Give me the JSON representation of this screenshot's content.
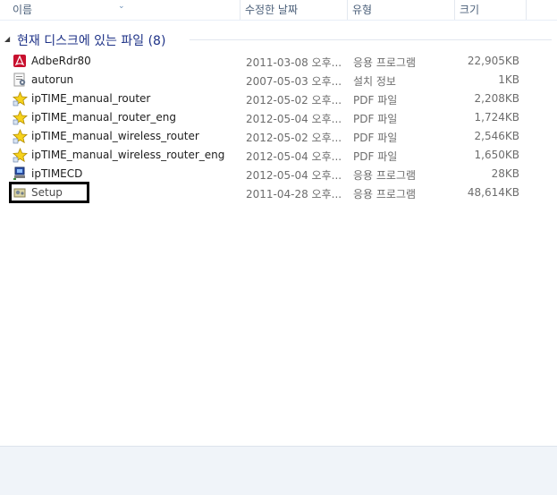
{
  "columns": {
    "name": "이름",
    "date": "수정한 날짜",
    "type": "유형",
    "size": "크기"
  },
  "group": {
    "title": "현재 디스크에 있는 파일 (8)"
  },
  "files": [
    {
      "name": "AdbeRdr80",
      "date": "2011-03-08 오후...",
      "type": "응용 프로그램",
      "size": "22,905KB",
      "icon": "adobe-reader-icon"
    },
    {
      "name": "autorun",
      "date": "2007-05-03 오후...",
      "type": "설치 정보",
      "size": "1KB",
      "icon": "setup-info-icon"
    },
    {
      "name": "ipTIME_manual_router",
      "date": "2012-05-02 오후...",
      "type": "PDF 파일",
      "size": "2,208KB",
      "icon": "pdf-star-icon"
    },
    {
      "name": "ipTIME_manual_router_eng",
      "date": "2012-05-04 오후...",
      "type": "PDF 파일",
      "size": "1,724KB",
      "icon": "pdf-star-icon"
    },
    {
      "name": "ipTIME_manual_wireless_router",
      "date": "2012-05-02 오후...",
      "type": "PDF 파일",
      "size": "2,546KB",
      "icon": "pdf-star-icon"
    },
    {
      "name": "ipTIME_manual_wireless_router_eng",
      "date": "2012-05-04 오후...",
      "type": "PDF 파일",
      "size": "1,650KB",
      "icon": "pdf-star-icon"
    },
    {
      "name": "ipTIMECD",
      "date": "2012-05-04 오후...",
      "type": "응용 프로그램",
      "size": "28KB",
      "icon": "app-icon"
    },
    {
      "name": "Setup",
      "date": "2011-04-28 오후...",
      "type": "응용 프로그램",
      "size": "48,614KB",
      "icon": "setup-icon"
    }
  ]
}
